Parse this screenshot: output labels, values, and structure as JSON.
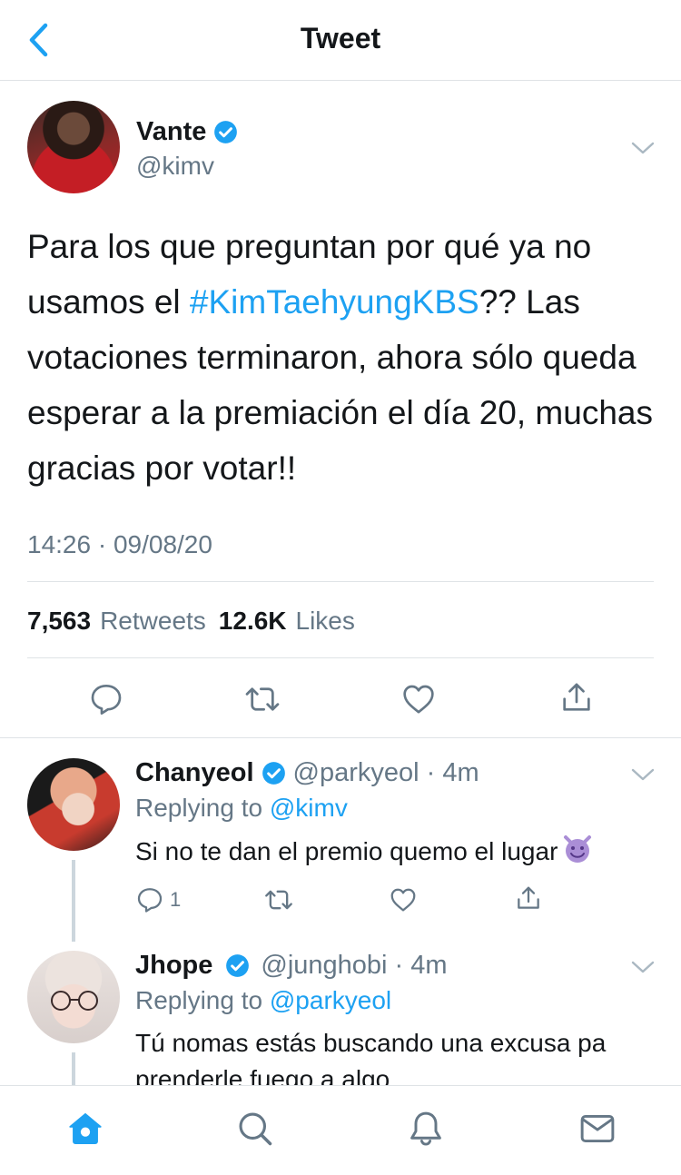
{
  "header": {
    "title": "Tweet"
  },
  "tweet": {
    "name": "Vante",
    "handle": "@kimv",
    "text_before": "Para los que preguntan por qué ya no usamos el ",
    "hashtag": "#KimTaehyungKBS",
    "text_after": "?? Las votaciones terminaron, ahora sólo queda esperar a la premiación el día 20, muchas gracias por votar!!",
    "timestamp": "14:26 · 09/08/20",
    "retweets_count": "7,563",
    "retweets_label": "Retweets",
    "likes_count": "12.6K",
    "likes_label": "Likes"
  },
  "replies": [
    {
      "name": "Chanyeol",
      "handle": "@parkyeol · 4m",
      "replying_prefix": "Replying to ",
      "replying_to": "@kimv",
      "text": "Si no te dan el premio quemo el lugar",
      "emoji": "smiling-imp",
      "reply_count": "1"
    },
    {
      "name": "Jhope",
      "handle": "@junghobi · 4m",
      "replying_prefix": "Replying to ",
      "replying_to": "@parkyeol",
      "text": "Tú nomas estás buscando una excusa pa prenderle fuego a algo"
    }
  ],
  "colors": {
    "accent": "#1da1f2",
    "verified": "#1da1f2",
    "muted": "#657786",
    "divider": "#dfe3e6"
  },
  "icons": {
    "back": "chevron-left-icon",
    "reply": "reply-icon",
    "retweet": "retweet-icon",
    "like": "heart-icon",
    "share": "share-icon",
    "home": "home-icon",
    "search": "search-icon",
    "notifications": "bell-icon",
    "messages": "mail-icon"
  }
}
